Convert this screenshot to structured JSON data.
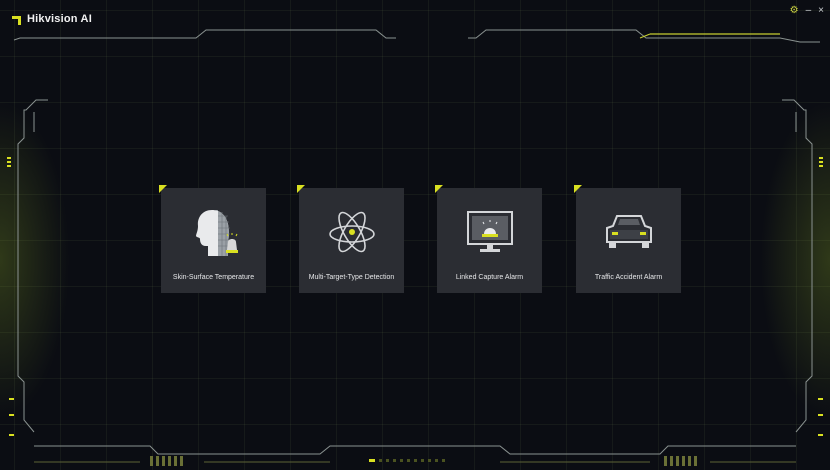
{
  "app": {
    "title": "Hikvision AI"
  },
  "window_controls": [
    {
      "name": "settings-icon",
      "glyph": "⚙"
    },
    {
      "name": "minimize-icon",
      "glyph": "–"
    },
    {
      "name": "close-icon",
      "glyph": "×"
    }
  ],
  "tiles": [
    {
      "label": "Skin-Surface Temperature",
      "icon": "head-temperature-icon",
      "selected": true
    },
    {
      "label": "Multi-Target-Type Detection",
      "icon": "atom-icon",
      "selected": false
    },
    {
      "label": "Linked Capture Alarm",
      "icon": "alarm-monitor-icon",
      "selected": false
    },
    {
      "label": "Traffic Accident Alarm",
      "icon": "car-icon",
      "selected": false
    }
  ],
  "colors": {
    "accent": "#d9e021",
    "background": "#0b0d13",
    "tile": "#2b2d33",
    "frame": "#8a9290"
  }
}
